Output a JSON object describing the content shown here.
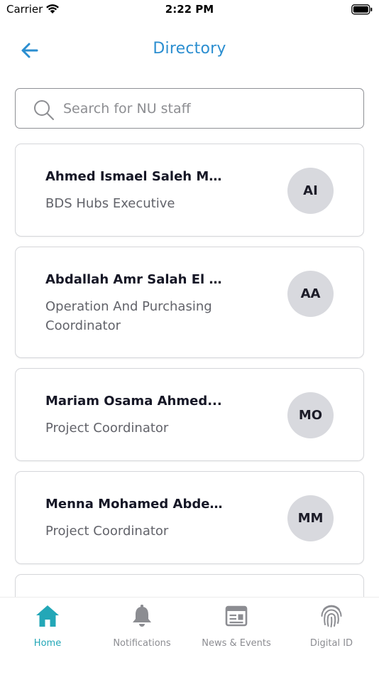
{
  "status_bar": {
    "carrier": "Carrier",
    "time": "2:22 PM"
  },
  "header": {
    "title": "Directory"
  },
  "search": {
    "placeholder": "Search for NU staff",
    "value": ""
  },
  "staff": [
    {
      "name": "Ahmed Ismael Saleh Mo...",
      "role": "BDS Hubs Executive",
      "initials": "AI"
    },
    {
      "name": "Abdallah Amr Salah El Di...",
      "role": "Operation And Purchasing Coordinator",
      "initials": "AA"
    },
    {
      "name": "Mariam Osama Ahmed...",
      "role": "Project Coordinator",
      "initials": "MO"
    },
    {
      "name": "Menna Mohamed Abdel...",
      "role": "Project Coordinator",
      "initials": "MM"
    },
    {
      "name": "",
      "role": "",
      "initials": ""
    }
  ],
  "tabs": [
    {
      "label": "Home",
      "icon": "home-icon",
      "active": true
    },
    {
      "label": "Notifications",
      "icon": "bell-icon",
      "active": false
    },
    {
      "label": "News & Events",
      "icon": "newspaper-icon",
      "active": false
    },
    {
      "label": "Digital ID",
      "icon": "fingerprint-icon",
      "active": false
    }
  ],
  "colors": {
    "accent": "#2b8ed0",
    "tab_active": "#23a7b7",
    "tab_inactive": "#8c8d92",
    "avatar_bg": "#d8d9de"
  }
}
